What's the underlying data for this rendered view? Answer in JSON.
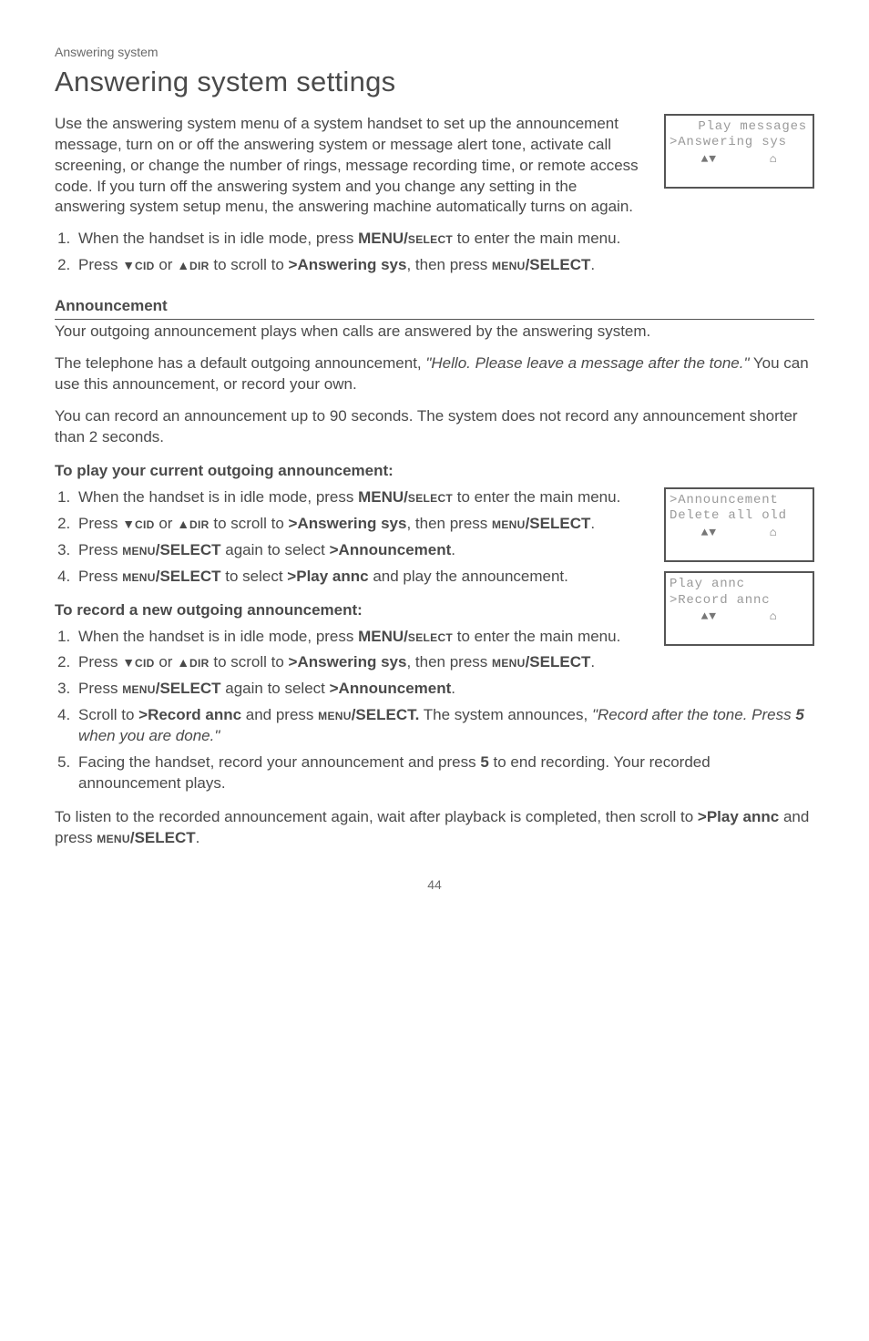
{
  "page_label": "Answering system",
  "h1": "Answering system settings",
  "intro": "Use the answering system menu of a system handset to set up the announcement message, turn on or off the answering system or message alert tone, activate call screening, or change the number of rings, message recording time, or remote access code. If you turn off the answering system and you change any setting in the answering system setup menu, the answering machine automatically turns on again.",
  "lcd1": {
    "line1": " Play messages",
    "line2": ">Answering sys",
    "arrows": "▲▼",
    "batt": "⌂"
  },
  "steps_main": {
    "s1_a": "When the handset is in idle mode, press ",
    "s1_b": "MENU/",
    "s1_c": "select",
    "s1_d": " to enter the main menu.",
    "s2_a": "Press ",
    "s2_cid": "cid",
    "s2_or": " or ",
    "s2_dir": "dir",
    "s2_b": " to scroll to ",
    "s2_target": ">Answering sys",
    "s2_c": ", then press ",
    "s2_menu": "menu",
    "s2_d": "/SELECT",
    "s2_e": "."
  },
  "announcement_h": "Announcement",
  "ann_p1": "Your outgoing announcement plays when calls are answered by the answering system.",
  "ann_p2_a": "The telephone has a default outgoing announcement, ",
  "ann_p2_quote": "\"Hello. Please leave a message after the tone.\"",
  "ann_p2_b": " You can use this announcement, or record your own.",
  "ann_p3": "You can record an announcement up to 90 seconds. The system does not record any announcement shorter than 2 seconds.",
  "play_h": "To play your current outgoing announcement:",
  "play": {
    "s1_a": "When the handset is in idle mode, press ",
    "s1_b": "MENU/",
    "s1_c": "select",
    "s1_d": " to enter the main menu.",
    "s2_a": "Press ",
    "s2_cid": "cid",
    "s2_or": " or ",
    "s2_dir": "dir",
    "s2_b": " to scroll to ",
    "s2_target": ">Answering sys",
    "s2_c": ", then press ",
    "s2_menu": "menu",
    "s2_sel": "/SELECT",
    "s2_d": ".",
    "s3_a": "Press ",
    "s3_menu": "menu",
    "s3_sel": "/SELECT",
    "s3_b": " again to select ",
    "s3_target": ">Announcement",
    "s3_c": ".",
    "s4_a": "Press ",
    "s4_menu": "menu",
    "s4_sel": "/SELECT",
    "s4_b": " to select ",
    "s4_target": ">Play annc",
    "s4_c": " and play the announcement."
  },
  "lcd2": {
    "line1": ">Announcement",
    "line2": " Delete all old",
    "arrows": "▲▼",
    "batt": "⌂"
  },
  "lcd3": {
    "line1": " Play annc",
    "line2": ">Record annc",
    "arrows": "▲▼",
    "batt": "⌂"
  },
  "record_h": "To record a new outgoing announcement:",
  "record": {
    "s1_a": "When the handset is in idle mode, press ",
    "s1_b": "MENU/",
    "s1_c": "select",
    "s1_d": " to enter the main menu.",
    "s2_a": "Press ",
    "s2_cid": "cid",
    "s2_or": " or ",
    "s2_dir": "dir",
    "s2_b": " to scroll to ",
    "s2_target": ">Answering sys",
    "s2_c": ", then press ",
    "s2_menu": "menu",
    "s2_sel": "/SELECT",
    "s2_d": ".",
    "s3_a": "Press ",
    "s3_menu": "menu",
    "s3_sel": "/SELECT",
    "s3_b": " again to select ",
    "s3_target": ">Announcement",
    "s3_c": ".",
    "s4_a": "Scroll to ",
    "s4_target": ">Record annc",
    "s4_b": " and press ",
    "s4_menu": "menu",
    "s4_sel": "/SELECT.",
    "s4_c": "  The system announces, ",
    "s4_quote_a": "\"Record after the tone. Press ",
    "s4_5": "5",
    "s4_quote_b": " when you are done.\"",
    "s5_a": "Facing the handset, record your announcement and press ",
    "s5_5": "5",
    "s5_b": " to end recording. Your recorded announcement plays."
  },
  "tail_a": "To listen to the recorded announcement again, wait after playback is completed, then scroll to ",
  "tail_target": ">Play annc",
  "tail_b": " and press ",
  "tail_menu": "menu",
  "tail_sel": "/SELECT",
  "tail_c": ".",
  "page_num": "44"
}
